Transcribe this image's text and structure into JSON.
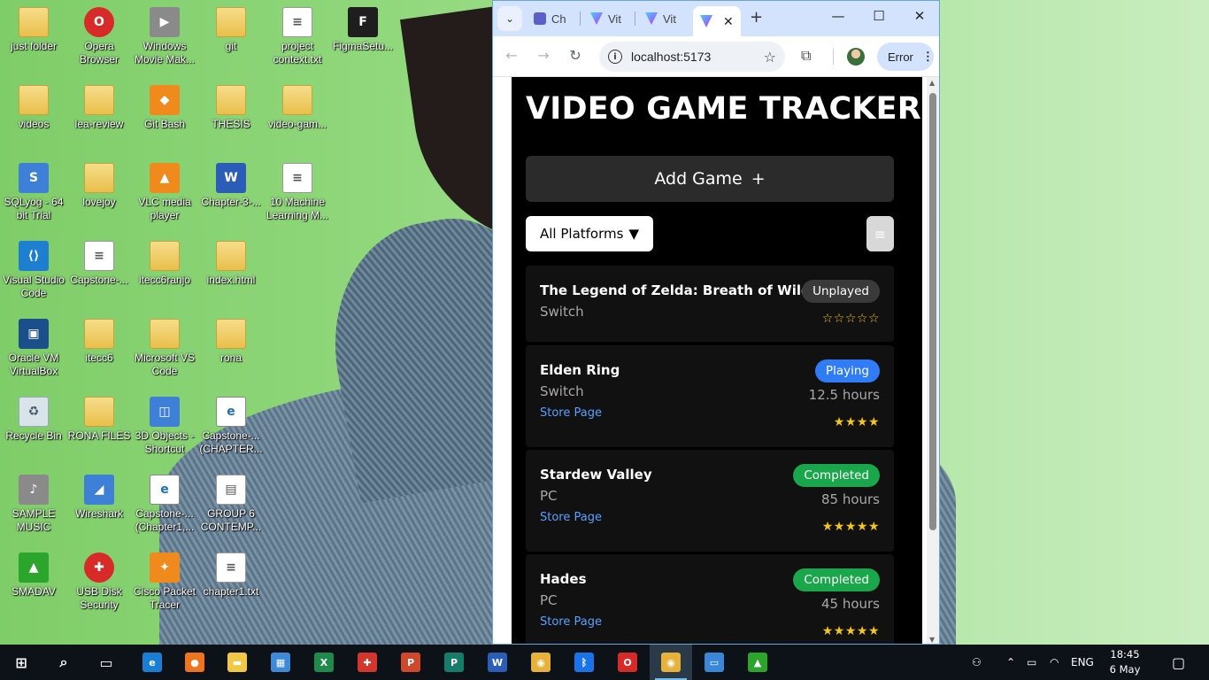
{
  "desktop": {
    "icons": [
      {
        "label": "just folder",
        "icon": "folder-icon"
      },
      {
        "label": "Opera Browser",
        "icon": "opera-icon"
      },
      {
        "label": "Windows Movie Mak...",
        "icon": "movie-maker-icon"
      },
      {
        "label": "git",
        "icon": "folder-icon"
      },
      {
        "label": "project context.txt",
        "icon": "text-file-icon"
      },
      {
        "label": "FigmaSetu...",
        "icon": "figma-icon"
      },
      {
        "label": "videos",
        "icon": "folder-icon"
      },
      {
        "label": "lea-review",
        "icon": "folder-icon"
      },
      {
        "label": "Git Bash",
        "icon": "git-bash-icon"
      },
      {
        "label": "THESIS",
        "icon": "folder-icon"
      },
      {
        "label": "video-gam...",
        "icon": "folder-icon"
      },
      {
        "label": "SQLyog - 64 bit Trial",
        "icon": "sqlyog-icon"
      },
      {
        "label": "lovejoy",
        "icon": "folder-icon"
      },
      {
        "label": "VLC media player",
        "icon": "vlc-icon"
      },
      {
        "label": "Chapter-3-...",
        "icon": "word-icon"
      },
      {
        "label": "10 Machine Learning M...",
        "icon": "document-icon"
      },
      {
        "label": "Visual Studio Code",
        "icon": "vscode-icon"
      },
      {
        "label": "Capstone-...",
        "icon": "document-icon"
      },
      {
        "label": "itecc6ranjo",
        "icon": "folder-icon"
      },
      {
        "label": "index.html",
        "icon": "folder-icon"
      },
      {
        "label": "Oracle VM VirtualBox",
        "icon": "virtualbox-icon"
      },
      {
        "label": "itecc6",
        "icon": "folder-icon"
      },
      {
        "label": "Microsoft VS Code",
        "icon": "folder-icon"
      },
      {
        "label": "rona",
        "icon": "folder-icon"
      },
      {
        "label": "Recycle Bin",
        "icon": "recycle-bin-icon"
      },
      {
        "label": "RONA FILES",
        "icon": "folder-icon"
      },
      {
        "label": "3D Objects - Shortcut",
        "icon": "3d-objects-icon"
      },
      {
        "label": "Capstone-... (CHAPTER...",
        "icon": "pdf-icon"
      },
      {
        "label": "SAMPLE MUSIC",
        "icon": "music-icon"
      },
      {
        "label": "Wireshark",
        "icon": "wireshark-icon"
      },
      {
        "label": "Capstone-... (Chapter1,...",
        "icon": "pdf-icon"
      },
      {
        "label": "GROUP 6 CONTEMP...",
        "icon": "image-file-icon"
      },
      {
        "label": "SMADAV",
        "icon": "smadav-icon"
      },
      {
        "label": "USB Disk Security",
        "icon": "usb-security-icon"
      },
      {
        "label": "Cisco Packet Tracer",
        "icon": "packet-tracer-icon"
      },
      {
        "label": "chapter1.txt",
        "icon": "text-file-icon"
      }
    ]
  },
  "browser": {
    "tabs": [
      {
        "label": "Ch",
        "favicon": "teams-icon",
        "active": false
      },
      {
        "label": "Vit",
        "favicon": "vite-icon",
        "active": false
      },
      {
        "label": "Vit",
        "favicon": "vite-icon",
        "active": false
      },
      {
        "label": "",
        "favicon": "vite-icon",
        "active": true
      }
    ],
    "url": "localhost:5173",
    "profile_chip": "Error"
  },
  "app": {
    "title": "VIDEO GAME TRACKER",
    "add_button": "Add Game",
    "add_button_icon": "+",
    "filter": {
      "selected": "All Platforms",
      "arrow": "▼"
    },
    "games": [
      {
        "title": "The Legend of Zelda: Breath of Wild",
        "platform": "Switch",
        "status": "Unplayed",
        "status_color": "#3a3a3a",
        "hours": "",
        "store_link": "",
        "rating": 0,
        "rating_text": "☆☆☆☆☆"
      },
      {
        "title": "Elden Ring",
        "platform": "Switch",
        "status": "Playing",
        "status_color": "#2f7cf6",
        "hours": "12.5 hours",
        "store_link": "Store Page",
        "rating": 4,
        "rating_text": "★★★★"
      },
      {
        "title": "Stardew Valley",
        "platform": "PC",
        "status": "Completed",
        "status_color": "#1aa64a",
        "hours": "85 hours",
        "store_link": "Store Page",
        "rating": 5,
        "rating_text": "★★★★★"
      },
      {
        "title": "Hades",
        "platform": "PC",
        "status": "Completed",
        "status_color": "#1aa64a",
        "hours": "45 hours",
        "store_link": "Store Page",
        "rating": 5,
        "rating_text": "★★★★★"
      }
    ]
  },
  "taskbar": {
    "apps": [
      "start-icon",
      "search-icon",
      "task-view-icon",
      "edge-icon",
      "firefox-icon",
      "file-explorer-icon",
      "store-icon",
      "excel-icon",
      "shield-icon",
      "powerpoint-icon",
      "publisher-icon",
      "word-icon",
      "chrome-icon",
      "bluetooth-icon",
      "opera-icon",
      "chrome-profile-icon",
      "window-icon",
      "smadav-icon"
    ],
    "language": "ENG",
    "time": "18:45",
    "date": "6 May 2025"
  },
  "colors": {
    "app_background": "#000000",
    "card_background": "#111111",
    "link": "#5aa0ff",
    "star": "#f5c518",
    "chrome_tabstrip": "#d3e3fd"
  }
}
